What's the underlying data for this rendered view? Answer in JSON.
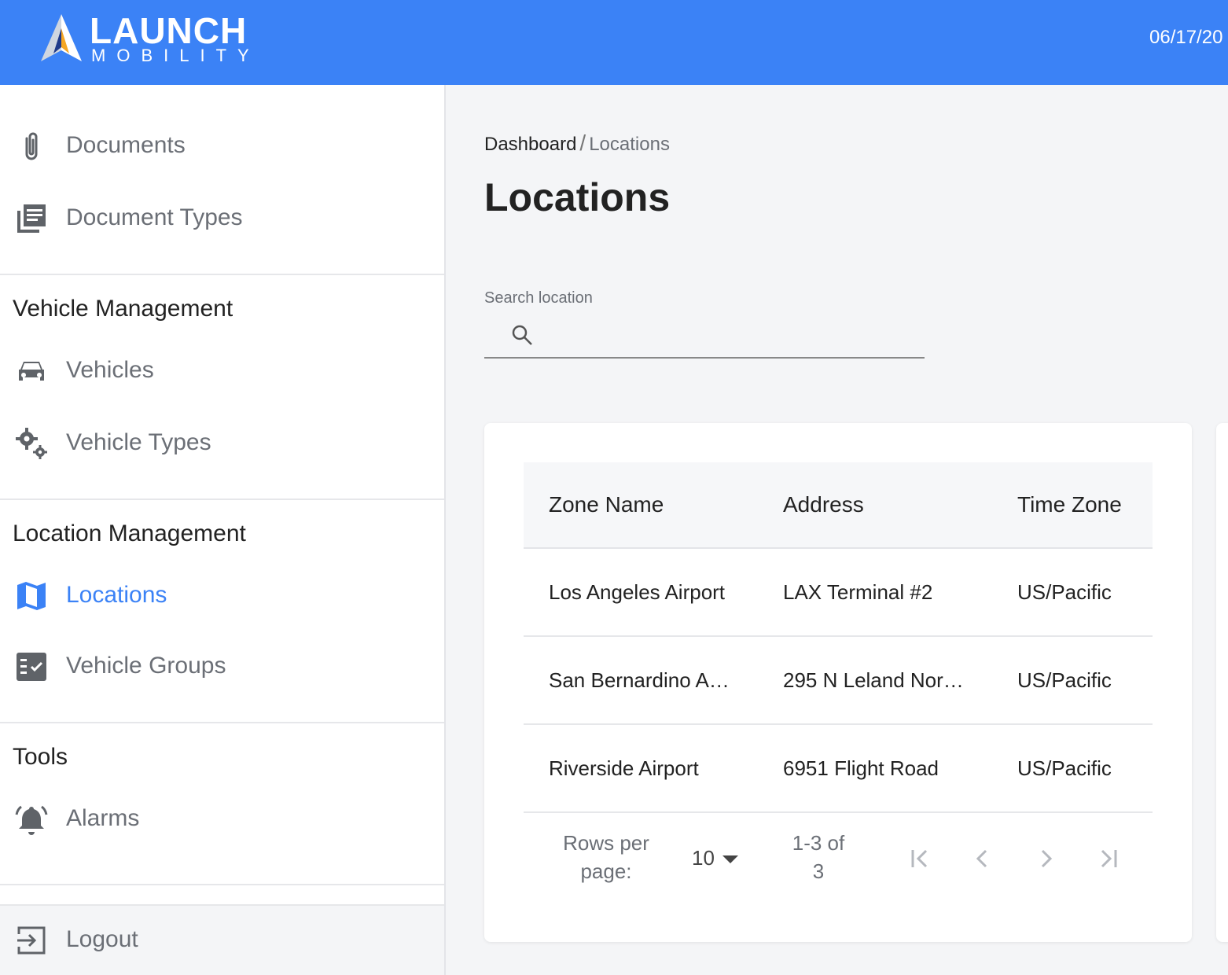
{
  "header": {
    "brand_title": "LAUNCH",
    "brand_subtitle": "MOBILITY",
    "date": "06/17/20",
    "background_color": "#3b82f6"
  },
  "sidebar": {
    "top_items": [
      {
        "label": "Documents",
        "icon": "paperclip-icon"
      },
      {
        "label": "Document Types",
        "icon": "library-books-icon"
      }
    ],
    "sections": [
      {
        "title": "Vehicle Management",
        "items": [
          {
            "label": "Vehicles",
            "icon": "car-icon"
          },
          {
            "label": "Vehicle Types",
            "icon": "gears-icon"
          }
        ]
      },
      {
        "title": "Location Management",
        "items": [
          {
            "label": "Locations",
            "icon": "map-icon",
            "active": true
          },
          {
            "label": "Vehicle Groups",
            "icon": "checklist-icon"
          }
        ]
      },
      {
        "title": "Tools",
        "items": [
          {
            "label": "Alarms",
            "icon": "alarm-bell-icon"
          }
        ]
      }
    ],
    "logout": {
      "label": "Logout",
      "icon": "logout-icon"
    },
    "active_color": "#3b82f6"
  },
  "breadcrumb": {
    "home": "Dashboard",
    "separator": "/",
    "current": "Locations"
  },
  "page_title": "Locations",
  "search": {
    "label": "Search location",
    "value": "",
    "placeholder": ""
  },
  "table": {
    "columns": [
      "Zone Name",
      "Address",
      "Time Zone"
    ],
    "rows": [
      [
        "Los Angeles Airport",
        "LAX Terminal #2",
        "US/Pacific"
      ],
      [
        "San Bernardino A…",
        "295 N Leland Nor…",
        "US/Pacific"
      ],
      [
        "Riverside Airport",
        "6951 Flight Road",
        "US/Pacific"
      ]
    ]
  },
  "pagination": {
    "rows_per_page_label_line1": "Rows per",
    "rows_per_page_label_line2": "page:",
    "rows_per_page_value": "10",
    "range_line1": "1-3 of",
    "range_line2": "3"
  }
}
